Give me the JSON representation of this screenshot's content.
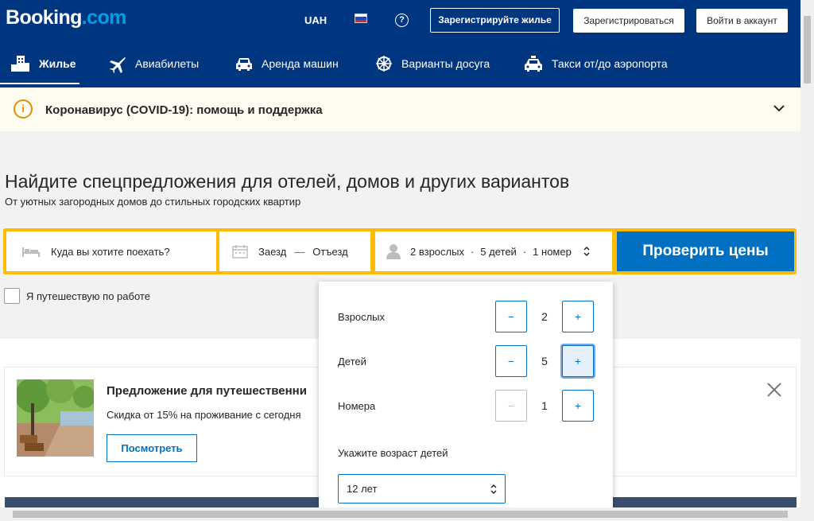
{
  "header": {
    "logo_main": "Booking",
    "logo_suffix": ".com",
    "currency": "UAH",
    "help_icon": "?",
    "list_property": "Зарегистрируйте жилье",
    "register": "Зарегистрироваться",
    "login": "Войти в аккаунт"
  },
  "nav": {
    "items": [
      {
        "label": "Жилье",
        "icon": "bed-building-icon",
        "active": true
      },
      {
        "label": "Авиабилеты",
        "icon": "plane-icon"
      },
      {
        "label": "Аренда машин",
        "icon": "car-icon"
      },
      {
        "label": "Варианты досуга",
        "icon": "attraction-icon"
      },
      {
        "label": "Такси от/до аэропорта",
        "icon": "taxi-icon"
      }
    ]
  },
  "covid": {
    "icon": "i",
    "text": "Коронавирус (COVID-19): помощь и поддержка"
  },
  "hero": {
    "title": "Найдите спецпредложения для отелей, домов и других вариантов",
    "subtitle": "От уютных загородных домов до стильных городских квартир"
  },
  "search": {
    "destination_placeholder": "Куда вы хотите поехать?",
    "checkin": "Заезд",
    "dash": "—",
    "checkout": "Отъезд",
    "guests_adults": "2 взрослых",
    "guests_children": "5 детей",
    "guests_rooms": "1 номер",
    "sep": "·",
    "submit": "Проверить цены"
  },
  "work_travel": {
    "label": "Я путешествую по работе"
  },
  "occupancy": {
    "rows": [
      {
        "label": "Взрослых",
        "value": "2"
      },
      {
        "label": "Детей",
        "value": "5"
      },
      {
        "label": "Номера",
        "value": "1"
      }
    ],
    "minus": "−",
    "plus": "+",
    "child_age_label": "Укажите возраст детей",
    "child_age_value": "12 лет"
  },
  "promo": {
    "title": "Предложение для путешественни",
    "text": "Скидка от 15% на проживание с сегодня",
    "button": "Посмотреть",
    "close_icon": "close-icon"
  },
  "colors": {
    "brand": "#003580",
    "accent": "#0071c2",
    "search_border": "#febb02",
    "logo_dot": "#009fe3"
  }
}
